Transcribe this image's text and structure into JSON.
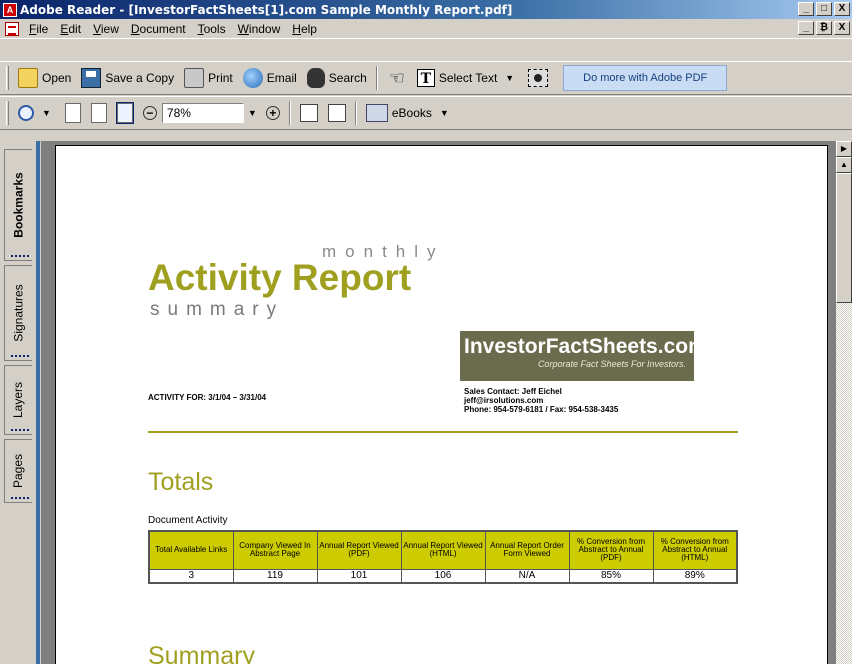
{
  "window": {
    "title": "Adobe Reader - [InvestorFactSheets[1].com Sample Monthly Report.pdf]",
    "buttons": [
      "_",
      "□",
      "X"
    ],
    "mdi_buttons": [
      "_",
      "₿",
      "X"
    ]
  },
  "menu": [
    "File",
    "Edit",
    "View",
    "Document",
    "Tools",
    "Window",
    "Help"
  ],
  "toolbar1": {
    "open": "Open",
    "save_copy": "Save a Copy",
    "print": "Print",
    "email": "Email",
    "search": "Search",
    "select_text": "Select Text",
    "promo": "Do more with Adobe PDF"
  },
  "toolbar2": {
    "zoom_value": "78%",
    "ebooks": "eBooks"
  },
  "side_tabs": [
    "Bookmarks",
    "Signatures",
    "Layers",
    "Pages"
  ],
  "report": {
    "monthly": "monthly",
    "title": "Activity Report",
    "summary_word": "summary",
    "logo_main": "InvestorFactSheets.com",
    "logo_sub": "Corporate Fact Sheets For Investors.",
    "activity_for": "ACTIVITY FOR:  3/1/04 – 3/31/04",
    "contact_line1": "Sales Contact: Jeff Eichel",
    "contact_line2": "jeff@irsolutions.com",
    "contact_line3": "Phone: 954-579-6181 / Fax: 954-538-3435",
    "totals_heading": "Totals",
    "doc_activity": "Document Activity",
    "table_headers": [
      "Total Available Links",
      "Company Viewed In Abstract Page",
      "Annual Report Viewed (PDF)",
      "Annual Report Viewed (HTML)",
      "Annual Report Order Form Viewed",
      "% Conversion from Abstract to Annual (PDF)",
      "% Conversion from Abstract to Annual (HTML)"
    ],
    "table_values": [
      "3",
      "119",
      "101",
      "106",
      "N/A",
      "85%",
      "89%"
    ],
    "summary_heading": "Summary"
  }
}
